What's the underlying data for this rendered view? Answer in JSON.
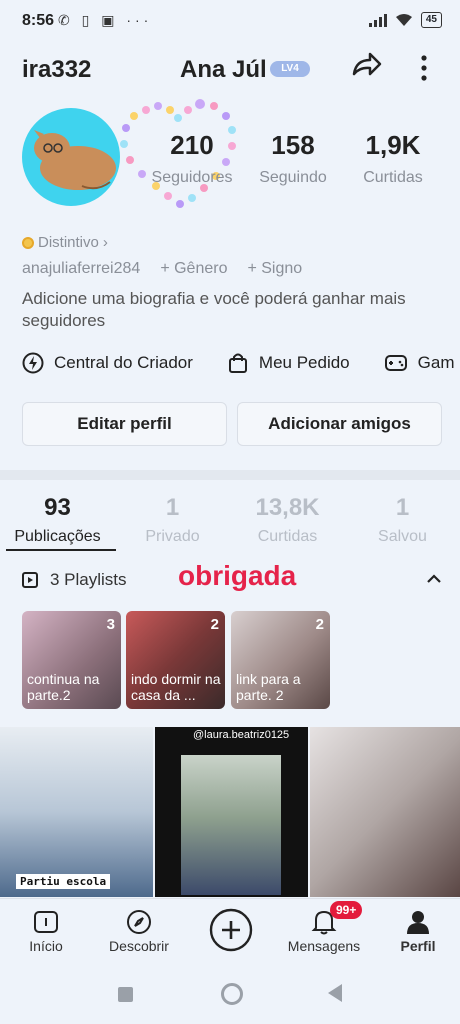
{
  "status_bar": {
    "time": "8:56",
    "battery": "45"
  },
  "header": {
    "username": "ira332",
    "display_name": "Ana Júl",
    "level": "LV4"
  },
  "stats": [
    {
      "value": "210",
      "label": "Seguidores"
    },
    {
      "value": "158",
      "label": "Seguindo"
    },
    {
      "value": "1,9K",
      "label": "Curtidas"
    }
  ],
  "profile": {
    "badge": "Distintivo",
    "handle": "anajuliaferrei284",
    "gender": "+ Gênero",
    "sign": "+ Signo",
    "bio": "Adicione uma biografia e você poderá ganhar mais seguidores"
  },
  "tools": [
    {
      "label": "Central do Criador",
      "icon": "lightning-icon"
    },
    {
      "label": "Meu Pedido",
      "icon": "bag-icon"
    },
    {
      "label": "Gam",
      "icon": "gamepad-icon"
    }
  ],
  "buttons": {
    "edit": "Editar perfil",
    "add_friends": "Adicionar amigos"
  },
  "tabs": [
    {
      "value": "93",
      "label": "Publicações"
    },
    {
      "value": "1",
      "label": "Privado"
    },
    {
      "value": "13,8K",
      "label": "Curtidas"
    },
    {
      "value": "1",
      "label": "Salvou"
    }
  ],
  "playlists": {
    "header": "3 Playlists",
    "overlay_text": "obrigada",
    "items": [
      {
        "count": "3",
        "caption": "continua na parte.2"
      },
      {
        "count": "2",
        "caption": "indo dormir na casa da ..."
      },
      {
        "count": "2",
        "caption": "link para a parte. 2"
      }
    ]
  },
  "videos": [
    {
      "caption": "Partiu escola"
    },
    {
      "caption": "@laura.beatriz0125"
    },
    {
      "caption": ""
    }
  ],
  "nav": [
    {
      "label": "Início",
      "icon": "home-icon"
    },
    {
      "label": "Descobrir",
      "icon": "compass-icon"
    },
    {
      "label": "",
      "icon": "plus-icon"
    },
    {
      "label": "Mensagens",
      "icon": "bell-icon"
    },
    {
      "label": "Perfil",
      "icon": "person-icon"
    }
  ],
  "message_badge": "99+",
  "colors": {
    "accent_red": "#e31b3c",
    "overlay_red": "#e5234a",
    "avatar_bg": "#3fd3ee",
    "level_badge": "#9fb7e8"
  }
}
